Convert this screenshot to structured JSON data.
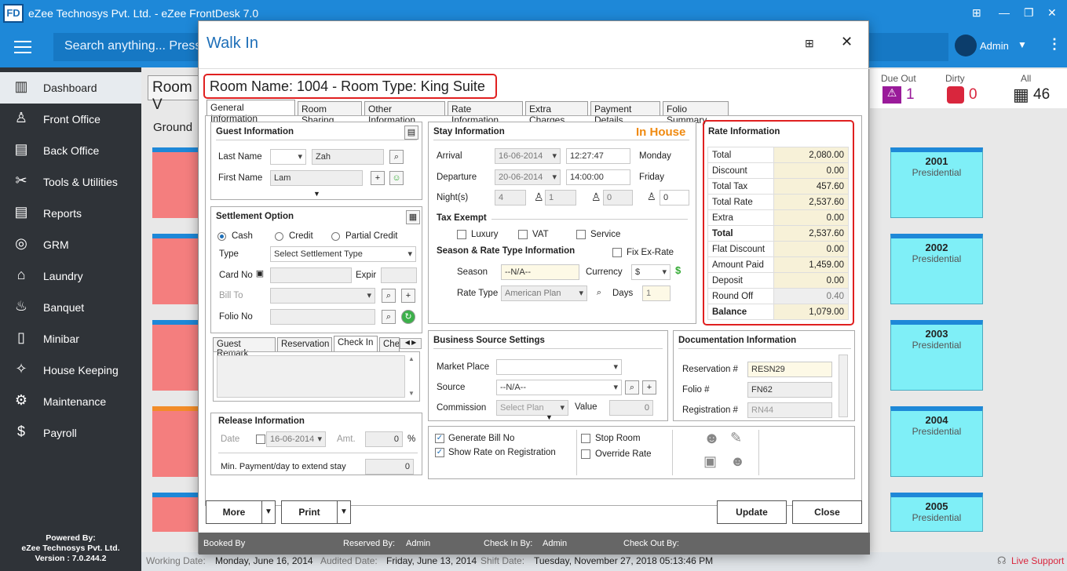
{
  "app": {
    "title": "eZee Technosys Pvt. Ltd. - eZee FrontDesk 7.0",
    "logo": "FD"
  },
  "topnav": {
    "search_placeholder": "Search anything... Press",
    "user": "Admin"
  },
  "sidebar": {
    "items": [
      {
        "label": "Dashboard",
        "icon": "chart-icon"
      },
      {
        "label": "Front Office",
        "icon": "person-icon"
      },
      {
        "label": "Back Office",
        "icon": "briefcase-icon"
      },
      {
        "label": "Tools & Utilities",
        "icon": "tools-icon"
      },
      {
        "label": "Reports",
        "icon": "report-icon"
      },
      {
        "label": "GRM",
        "icon": "grm-icon"
      },
      {
        "label": "Laundry",
        "icon": "iron-icon"
      },
      {
        "label": "Banquet",
        "icon": "banquet-icon"
      },
      {
        "label": "Minibar",
        "icon": "minibar-icon"
      },
      {
        "label": "House Keeping",
        "icon": "housekeeping-icon"
      },
      {
        "label": "Maintenance",
        "icon": "maintenance-icon"
      },
      {
        "label": "Payroll",
        "icon": "payroll-icon"
      }
    ],
    "powered_line1": "Powered By:",
    "powered_line2": "eZee Technosys Pvt. Ltd.",
    "version": "Version : 7.0.244.2"
  },
  "background": {
    "room_view": "Room V",
    "ground": "Ground",
    "due_out_label": "Due Out",
    "due_out_count": "1",
    "dirty_label": "Dirty",
    "dirty_count": "0",
    "all_label": "All",
    "all_count": "46",
    "rooms": [
      {
        "no": "2001",
        "type": "Presidential"
      },
      {
        "no": "2002",
        "type": "Presidential"
      },
      {
        "no": "2003",
        "type": "Presidential"
      },
      {
        "no": "2004",
        "type": "Presidential"
      },
      {
        "no": "2005",
        "type": "Presidential"
      }
    ]
  },
  "statusbar": {
    "working_date_label": "Working Date:",
    "working_date": "Monday, June 16, 2014",
    "audited_label": "Audited Date:",
    "audited_date": "Friday, June 13, 2014",
    "shift_label": "Shift Date:",
    "shift_date": "Tuesday, November 27, 2018 05:13:46 PM",
    "live_support": "Live Support"
  },
  "dialog": {
    "title": "Walk In",
    "room_heading": "Room Name: 1004 - Room Type: King Suite",
    "tabs": [
      "General Information",
      "Room Sharing",
      "Other Information",
      "Rate Information",
      "Extra Charges",
      "Payment Details",
      "Folio Summary"
    ],
    "guest": {
      "header": "Guest Information",
      "last_name_label": "Last Name",
      "last_name": "Zah",
      "first_name_label": "First Name",
      "first_name": "Lam"
    },
    "settlement": {
      "header": "Settlement Option",
      "cash": "Cash",
      "credit": "Credit",
      "partial": "Partial Credit",
      "type_label": "Type",
      "type_value": "Select Settlement Type",
      "card_label": "Card No",
      "expiry_label": "Expir",
      "bill_to_label": "Bill To",
      "folio_label": "Folio No"
    },
    "remark_tabs": [
      "Guest Remark",
      "Reservation",
      "Check In",
      "Che"
    ],
    "release": {
      "header": "Release Information",
      "date_label": "Date",
      "date": "16-06-2014",
      "amt_label": "Amt.",
      "amt": "0",
      "pct": "%",
      "min_label": "Min. Payment/day to extend stay",
      "min_value": "0"
    },
    "stay": {
      "header": "Stay Information",
      "status": "In House",
      "arrival_label": "Arrival",
      "arrival_date": "16-06-2014",
      "arrival_time": "12:27:47",
      "arrival_day": "Monday",
      "departure_label": "Departure",
      "departure_date": "20-06-2014",
      "departure_time": "14:00:00",
      "departure_day": "Friday",
      "nights_label": "Night(s)",
      "nights": "4",
      "adults": "1",
      "children": "0",
      "infants": "0",
      "tax_exempt": "Tax Exempt",
      "luxury": "Luxury",
      "vat": "VAT",
      "service": "Service",
      "season_header": "Season & Rate Type Information",
      "fix_ex_rate": "Fix Ex-Rate",
      "season_label": "Season",
      "season": "--N/A--",
      "currency_label": "Currency",
      "currency": "$",
      "rate_type_label": "Rate Type",
      "rate_type": "American Plan",
      "days_label": "Days",
      "days": "1"
    },
    "rate": {
      "header": "Rate Information",
      "rows": [
        {
          "label": "Total",
          "value": "2,080.00"
        },
        {
          "label": "Discount",
          "value": "0.00"
        },
        {
          "label": "Total Tax",
          "value": "457.60"
        },
        {
          "label": "Total Rate",
          "value": "2,537.60"
        },
        {
          "label": "Extra",
          "value": "0.00"
        },
        {
          "label": "Total",
          "value": "2,537.60"
        },
        {
          "label": "Flat Discount",
          "value": "0.00"
        },
        {
          "label": "Amount Paid",
          "value": "1,459.00"
        },
        {
          "label": "Deposit",
          "value": "0.00"
        },
        {
          "label": "Round Off",
          "value": "0.40"
        },
        {
          "label": "Balance",
          "value": "1,079.00"
        }
      ]
    },
    "business": {
      "header": "Business Source Settings",
      "market_label": "Market Place",
      "source_label": "Source",
      "source": "--N/A--",
      "commission_label": "Commission",
      "commission": "Select Plan",
      "value_label": "Value",
      "value": "0"
    },
    "documentation": {
      "header": "Documentation Information",
      "reservation_label": "Reservation #",
      "reservation": "RESN29",
      "folio_label": "Folio #",
      "folio": "FN62",
      "registration_label": "Registration #",
      "registration": "RN44"
    },
    "options": {
      "generate_bill": "Generate Bill No",
      "show_rate": "Show Rate on Registration",
      "stop_room": "Stop Room",
      "override_rate": "Override Rate"
    },
    "buttons": {
      "more": "More",
      "print": "Print",
      "update": "Update",
      "close": "Close"
    },
    "footer": {
      "booked_by": "Booked By",
      "reserved_by": "Reserved By:",
      "reserved_value": "Admin",
      "check_in_by": "Check In By:",
      "check_in_value": "Admin",
      "check_out_by": "Check Out By:"
    }
  }
}
